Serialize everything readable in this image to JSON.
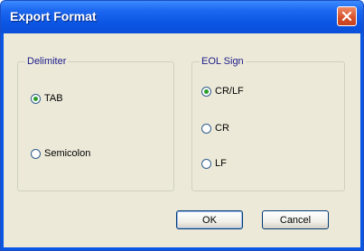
{
  "window": {
    "title": "Export Format"
  },
  "delimiter_group": {
    "label": "Delimiter",
    "options": [
      {
        "label": "TAB",
        "selected": true
      },
      {
        "label": "Semicolon",
        "selected": false
      }
    ]
  },
  "eol_group": {
    "label": "EOL Sign",
    "options": [
      {
        "label": "CR/LF",
        "selected": true
      },
      {
        "label": "CR",
        "selected": false
      },
      {
        "label": "LF",
        "selected": false
      }
    ]
  },
  "buttons": {
    "ok": "OK",
    "cancel": "Cancel"
  },
  "icons": {
    "close": "close-icon"
  },
  "colors": {
    "titlebar": "#0a56e6",
    "client": "#ece9d8",
    "close": "#d5502a",
    "radio_selected": "#2a9d2a"
  }
}
